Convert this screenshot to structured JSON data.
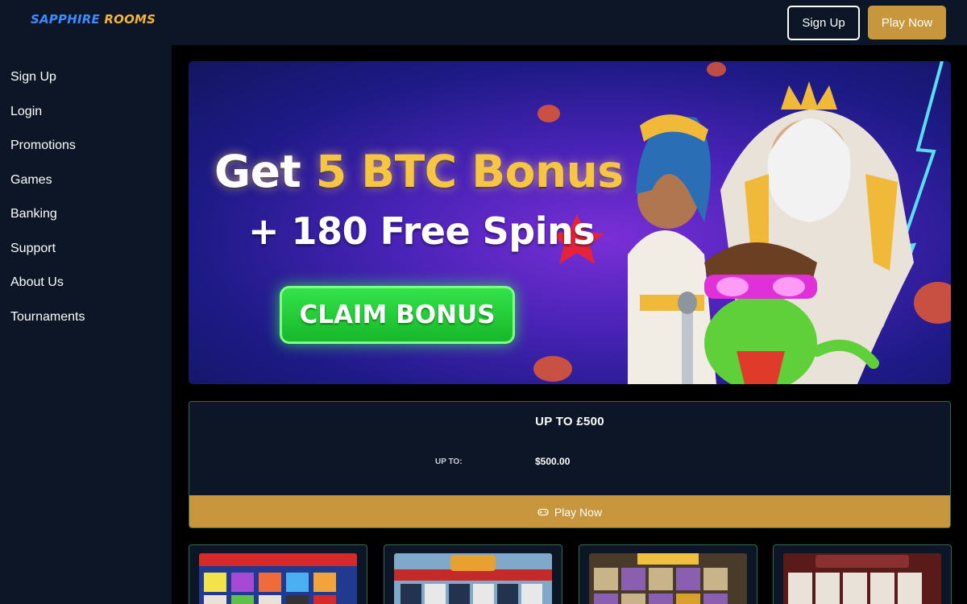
{
  "header": {
    "logo_word1": "SAPPHIRE",
    "logo_word2": "ROOMS",
    "signup_label": "Sign Up",
    "playnow_label": "Play Now"
  },
  "sidebar": {
    "items": [
      {
        "label": "Sign Up"
      },
      {
        "label": "Login"
      },
      {
        "label": "Promotions"
      },
      {
        "label": "Games"
      },
      {
        "label": "Banking"
      },
      {
        "label": "Support"
      },
      {
        "label": "About Us"
      },
      {
        "label": "Tournaments"
      }
    ]
  },
  "banner": {
    "title_prefix": "Get ",
    "title_highlight": "5 BTC Bonus",
    "subtitle": "+ 180 Free Spins",
    "cta_label": "CLAIM BONUS"
  },
  "offer": {
    "title": "UP TO £500",
    "label": "UP TO:",
    "value": "$500.00",
    "play_label": "Play Now"
  },
  "games": [
    {
      "icon": "game-thumbnail-family-guy"
    },
    {
      "icon": "game-thumbnail-wild-diner"
    },
    {
      "icon": "game-thumbnail-wild-west"
    },
    {
      "icon": "game-thumbnail-cash-o-casino"
    }
  ],
  "colors": {
    "accent_gold": "#c8963c",
    "nav_bg": "#0c1626",
    "card_border": "#2e6b4a",
    "cta_green": "#18b82a",
    "logo_blue": "#3d8bff",
    "logo_gold": "#f2b43a"
  }
}
